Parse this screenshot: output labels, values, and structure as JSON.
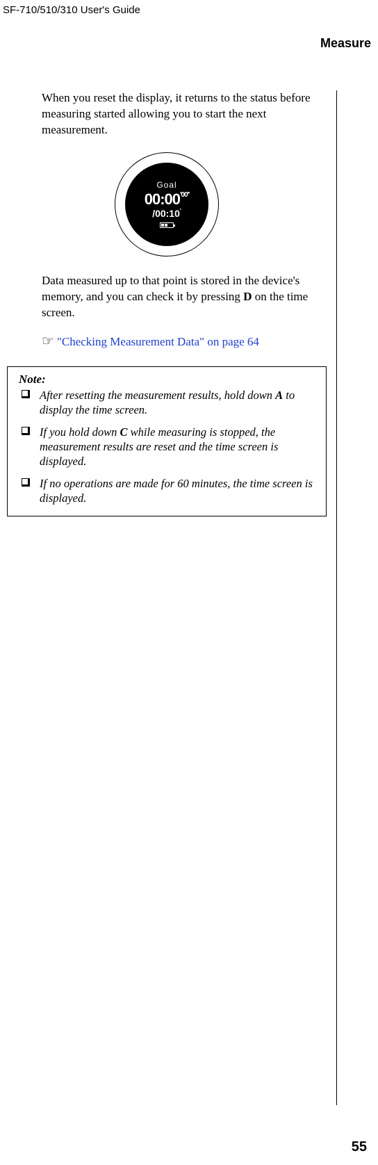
{
  "header": {
    "model": "SF-710/510/310     User's Guide",
    "section": "Measure"
  },
  "body": {
    "p1": "When you reset the display, it returns to the status before measuring started allowing you to start the next measurement.",
    "p2_a": "Data measured up to that point is stored in the device's memory, and you can check it by pressing ",
    "p2_b": "D",
    "p2_c": " on the time screen."
  },
  "watch": {
    "goal": "Goal",
    "main_time": "00:00",
    "main_frac": "'00''",
    "sub_time": "/00:10",
    "sub_frac": "'"
  },
  "reference": {
    "icon": "☞",
    "link_text": "\"Checking Measurement Data\" on page 64"
  },
  "note": {
    "title": "Note:",
    "items": [
      {
        "pre": "After resetting the measurement results, hold down ",
        "b": "A",
        "post": " to display the time screen."
      },
      {
        "pre": "If you hold down ",
        "b": "C",
        "post": " while measuring is stopped, the measurement results are reset and the time screen is displayed."
      },
      {
        "pre": "If no operations are made for 60 minutes, the time screen is displayed.",
        "b": "",
        "post": ""
      }
    ]
  },
  "footer": {
    "page": "55"
  }
}
